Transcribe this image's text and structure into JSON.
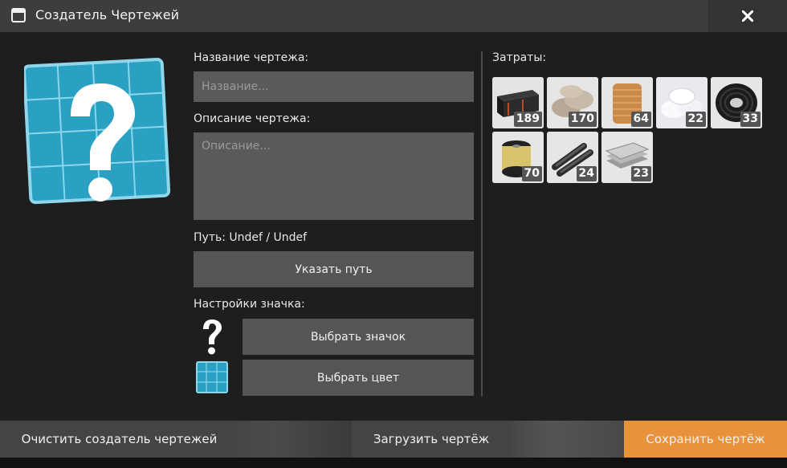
{
  "window": {
    "title": "Создатель Чертежей"
  },
  "form": {
    "name_label": "Название чертежа:",
    "name_value": "",
    "name_placeholder": "Название...",
    "desc_label": "Описание чертежа:",
    "desc_value": "",
    "desc_placeholder": "Описание...",
    "path_label": "Путь: Undef / Undef",
    "set_path_button": "Указать путь",
    "icon_settings_label": "Настройки значка:",
    "choose_icon_button": "Выбрать значок",
    "choose_color_button": "Выбрать цвет"
  },
  "costs": {
    "label": "Затраты:",
    "items": [
      {
        "icon": "rubber-strips-icon",
        "count": "189"
      },
      {
        "icon": "cement-bags-icon",
        "count": "170"
      },
      {
        "icon": "copper-wire-spool-icon",
        "count": "64"
      },
      {
        "icon": "white-sacks-icon",
        "count": "22"
      },
      {
        "icon": "black-cable-coil-icon",
        "count": "33"
      },
      {
        "icon": "gold-wire-spool-icon",
        "count": "70"
      },
      {
        "icon": "steel-rods-icon",
        "count": "24"
      },
      {
        "icon": "metal-sheets-icon",
        "count": "23"
      }
    ]
  },
  "bottom": {
    "clear_button": "Очистить создатель чертежей",
    "load_button": "Загрузить чертёж",
    "save_button": "Сохранить чертёж"
  },
  "colors": {
    "accent_save": "#e8923c",
    "blueprint": "#2fa3c4"
  }
}
